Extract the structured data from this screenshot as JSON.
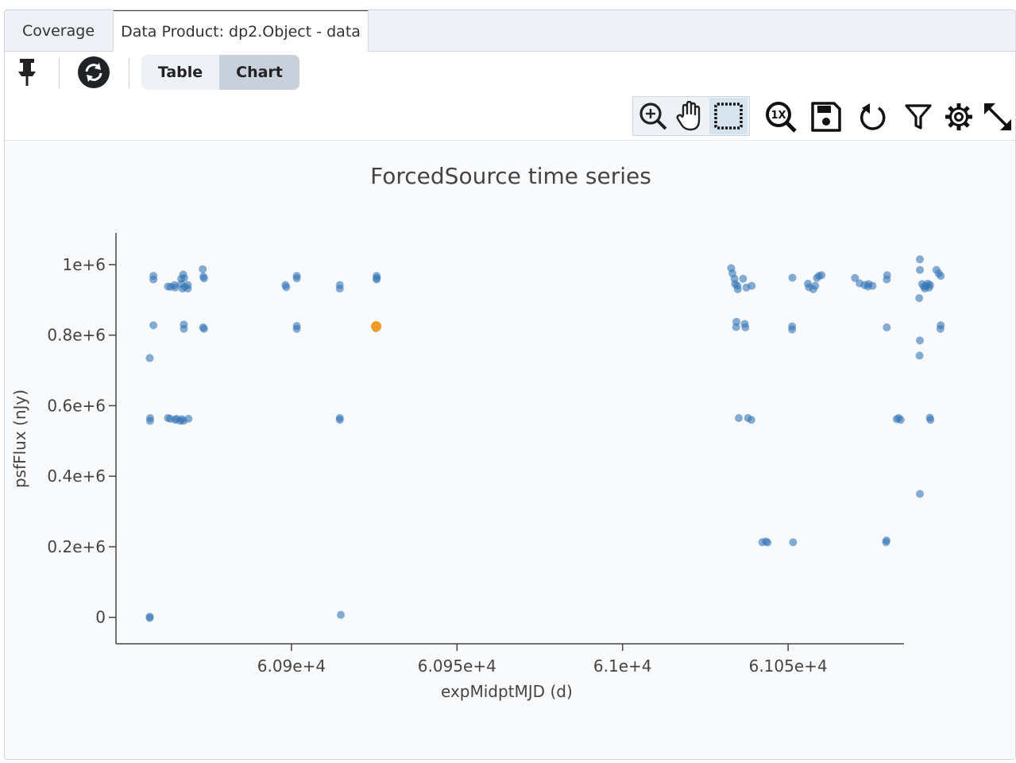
{
  "tabs": [
    {
      "label": "Coverage"
    },
    {
      "label": "Data Product: dp2.Object - data"
    }
  ],
  "toolbar": {
    "view_toggle": {
      "table_label": "Table",
      "chart_label": "Chart",
      "selected": "Chart"
    },
    "icons": [
      "pin-icon",
      "sync-icon",
      "zoom-in-icon",
      "pan-hand-icon",
      "select-box-icon",
      "zoom-reset-1x-icon",
      "save-icon",
      "restore-icon",
      "filter-icon",
      "settings-gear-icon",
      "expand-icon"
    ],
    "zoom_reset_label": "1X"
  },
  "colors": {
    "point": "#3677b5",
    "highlight": "#f39a24",
    "axis": "#444444"
  },
  "chart_data": {
    "type": "scatter",
    "title": "ForcedSource time series",
    "xlabel": "expMidptMJD (d)",
    "ylabel": "psfFlux (nJy)",
    "xlim": [
      60847,
      61085
    ],
    "ylim": [
      -75000,
      1090000
    ],
    "x_ticks": [
      60900,
      60950,
      61000,
      61050
    ],
    "x_tick_labels": [
      "6.09e+4",
      "6.095e+4",
      "6.1e+4",
      "6.105e+4"
    ],
    "y_ticks": [
      0,
      200000,
      400000,
      600000,
      800000,
      1000000
    ],
    "y_tick_labels": [
      "0",
      "0.2e+6",
      "0.4e+6",
      "0.6e+6",
      "0.8e+6",
      "1e+6"
    ],
    "grid": false,
    "series": [
      {
        "points": [
          [
            60858.3,
            968000
          ],
          [
            60858.3,
            958000
          ],
          [
            60858.3,
            828000
          ],
          [
            60857.2,
            735000
          ],
          [
            60857.3,
            565000
          ],
          [
            60857.3,
            557000
          ],
          [
            60857.2,
            2000
          ],
          [
            60857.2,
            -2000
          ],
          [
            60862.7,
            938000
          ],
          [
            60863.5,
            937000
          ],
          [
            60864.7,
            942000
          ],
          [
            60864.9,
            935000
          ],
          [
            60866.7,
            945000
          ],
          [
            60867.1,
            932000
          ],
          [
            60867.8,
            937000
          ],
          [
            60866.7,
            960000
          ],
          [
            60867.3,
            972000
          ],
          [
            60867.6,
            962000
          ],
          [
            60868.7,
            942000
          ],
          [
            60868.7,
            932000
          ],
          [
            60867.5,
            830000
          ],
          [
            60867.5,
            818000
          ],
          [
            60862.7,
            565000
          ],
          [
            60863.4,
            563000
          ],
          [
            60864.9,
            560000
          ],
          [
            60865.3,
            563000
          ],
          [
            60866.4,
            557000
          ],
          [
            60866.9,
            562000
          ],
          [
            60867.4,
            557000
          ],
          [
            60868.9,
            563000
          ],
          [
            60873.2,
            987000
          ],
          [
            60873.4,
            966000
          ],
          [
            60873.6,
            961000
          ],
          [
            60873.3,
            822000
          ],
          [
            60873.6,
            818000
          ],
          [
            60898.2,
            942000
          ],
          [
            60898.4,
            936000
          ],
          [
            60901.6,
            968000
          ],
          [
            60901.6,
            961000
          ],
          [
            60901.6,
            826000
          ],
          [
            60901.6,
            818000
          ],
          [
            60914.6,
            942000
          ],
          [
            60914.6,
            932000
          ],
          [
            60914.6,
            565000
          ],
          [
            60914.6,
            560000
          ],
          [
            60914.9,
            7000
          ],
          [
            60925.7,
            968000
          ],
          [
            60925.8,
            962000
          ],
          [
            60925.7,
            958000
          ],
          [
            60925.5,
            828000
          ],
          [
            60925.5,
            820000
          ],
          [
            61032.8,
            990000
          ],
          [
            61033.2,
            975000
          ],
          [
            61033.8,
            960000
          ],
          [
            61034.0,
            945000
          ],
          [
            61034.7,
            940000
          ],
          [
            61034.8,
            930000
          ],
          [
            61036.4,
            960000
          ],
          [
            61037.4,
            935000
          ],
          [
            61039.0,
            940000
          ],
          [
            61034.4,
            838000
          ],
          [
            61034.3,
            823000
          ],
          [
            61036.9,
            832000
          ],
          [
            61037.1,
            822000
          ],
          [
            61035.1,
            565000
          ],
          [
            61037.9,
            565000
          ],
          [
            61038.9,
            560000
          ],
          [
            61042.2,
            213000
          ],
          [
            61043.3,
            215000
          ],
          [
            61043.8,
            212000
          ],
          [
            61051.3,
            963000
          ],
          [
            61051.2,
            825000
          ],
          [
            61051.2,
            816000
          ],
          [
            61051.5,
            213000
          ],
          [
            61056.0,
            946000
          ],
          [
            61056.3,
            936000
          ],
          [
            61057.6,
            930000
          ],
          [
            61058.2,
            940000
          ],
          [
            61058.7,
            962000
          ],
          [
            61059.3,
            968000
          ],
          [
            61060.1,
            970000
          ],
          [
            61070.2,
            962000
          ],
          [
            61071.6,
            947000
          ],
          [
            61073.1,
            942000
          ],
          [
            61074.1,
            938000
          ],
          [
            61074.3,
            945000
          ],
          [
            61075.5,
            940000
          ],
          [
            61079.9,
            970000
          ],
          [
            61079.8,
            958000
          ],
          [
            61079.8,
            822000
          ],
          [
            61079.7,
            218000
          ],
          [
            61079.6,
            213000
          ],
          [
            61082.8,
            562000
          ],
          [
            61083.4,
            565000
          ],
          [
            61084.0,
            560000
          ],
          [
            61089.8,
            1015000
          ],
          [
            61089.8,
            985000
          ],
          [
            61089.6,
            905000
          ],
          [
            61089.8,
            785000
          ],
          [
            61089.7,
            742000
          ],
          [
            61089.8,
            350000
          ],
          [
            61090.5,
            945000
          ],
          [
            61091.0,
            938000
          ],
          [
            61091.3,
            932000
          ],
          [
            61091.7,
            940000
          ],
          [
            61092.2,
            946000
          ],
          [
            61092.6,
            935000
          ],
          [
            61092.9,
            942000
          ],
          [
            61092.8,
            566000
          ],
          [
            61093.0,
            560000
          ],
          [
            61094.8,
            985000
          ],
          [
            61095.5,
            975000
          ],
          [
            61096.1,
            968000
          ],
          [
            61096.1,
            828000
          ],
          [
            61096.0,
            818000
          ]
        ]
      },
      {
        "highlight": true,
        "points": [
          [
            60925.6,
            825000
          ]
        ]
      }
    ]
  }
}
